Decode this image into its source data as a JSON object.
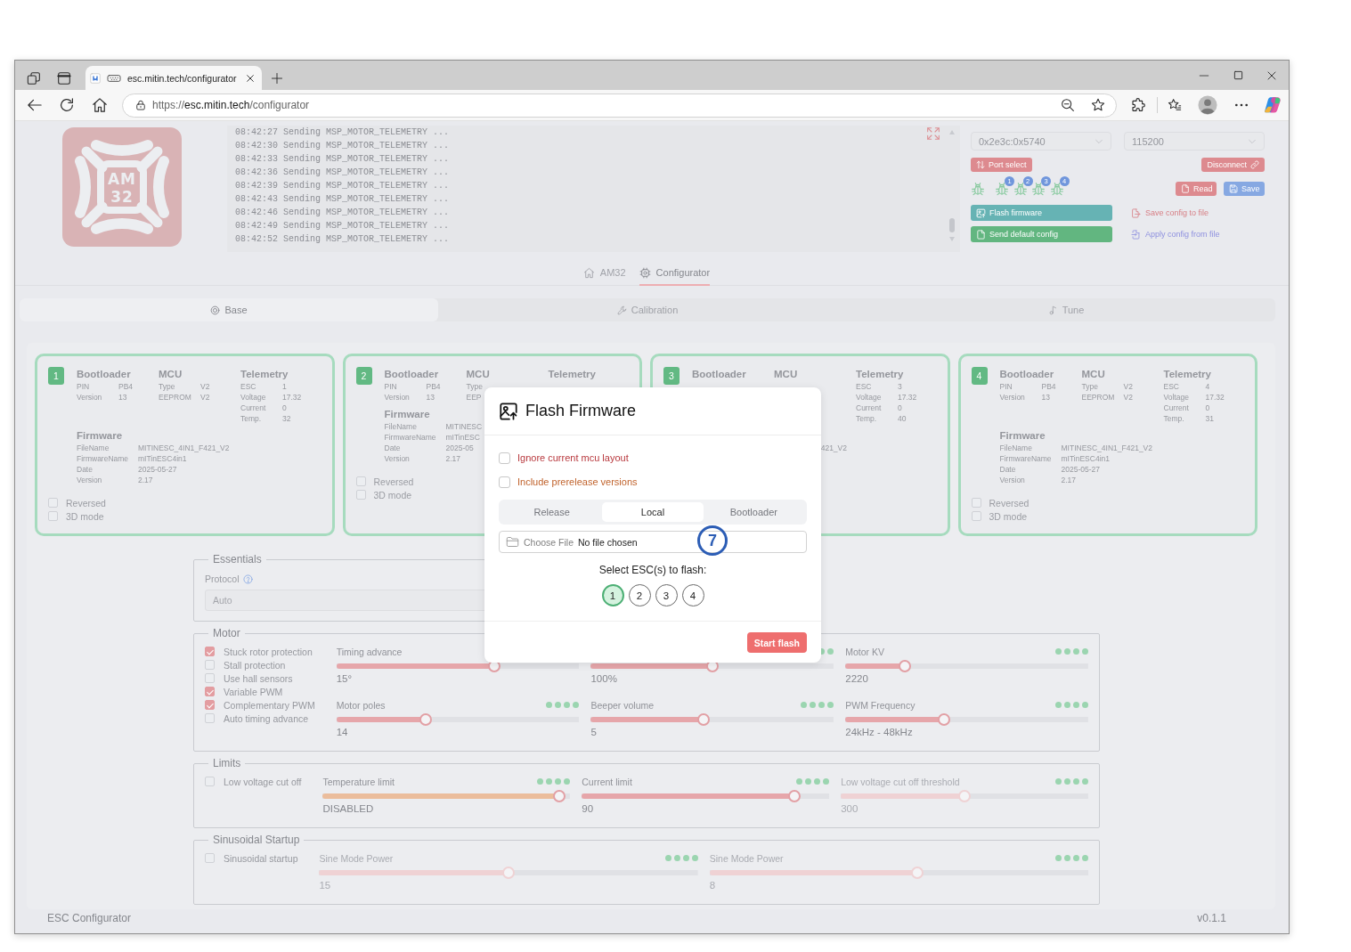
{
  "browser": {
    "tab_title": "esc.mitin.tech/configurator",
    "url": "https://**esc.mitin.tech**/configurator"
  },
  "logo": {
    "lines": [
      "AM",
      "32"
    ]
  },
  "log": {
    "lines": [
      "08:42:27 Sending MSP_MOTOR_TELEMETRY ...",
      "08:42:30 Sending MSP_MOTOR_TELEMETRY ...",
      "08:42:33 Sending MSP_MOTOR_TELEMETRY ...",
      "08:42:36 Sending MSP_MOTOR_TELEMETRY ...",
      "08:42:39 Sending MSP_MOTOR_TELEMETRY ...",
      "08:42:43 Sending MSP_MOTOR_TELEMETRY ...",
      "08:42:46 Sending MSP_MOTOR_TELEMETRY ...",
      "08:42:49 Sending MSP_MOTOR_TELEMETRY ...",
      "08:42:52 Sending MSP_MOTOR_TELEMETRY ..."
    ]
  },
  "connection": {
    "port": "0x2e3c:0x5740",
    "baud": "115200",
    "port_select": "Port select",
    "disconnect": "Disconnect",
    "devices": [
      {
        "kind": "plain"
      },
      {
        "kind": "numbered",
        "badge": "1"
      },
      {
        "kind": "numbered",
        "badge": "2"
      },
      {
        "kind": "numbered",
        "badge": "3"
      },
      {
        "kind": "numbered",
        "badge": "4"
      }
    ],
    "read": "Read",
    "save": "Save",
    "flash_firmware": "Flash firmware",
    "send_default_config": "Send default config",
    "save_config": "Save config to file",
    "apply_config": "Apply config from file"
  },
  "nav": [
    {
      "label": "AM32",
      "selected": false
    },
    {
      "label": "Configurator",
      "selected": true
    }
  ],
  "sections": [
    {
      "label": "Base",
      "selected": true
    },
    {
      "label": "Calibration",
      "selected": false
    },
    {
      "label": "Tune",
      "selected": false
    }
  ],
  "escs": [
    {
      "number": "1",
      "sections": [
        {
          "title": "Bootloader",
          "rows": [
            {
              "label": "PIN",
              "value": "PB4"
            },
            {
              "label": "Version",
              "value": "13"
            }
          ]
        },
        {
          "title": "MCU",
          "rows": [
            {
              "label": "Type",
              "value": "V2"
            },
            {
              "label": "EEPROM",
              "value": "V2"
            }
          ]
        },
        {
          "title": "Telemetry",
          "rows": [
            {
              "label": "ESC",
              "value": "1"
            },
            {
              "label": "Voltage",
              "value": "17.32"
            },
            {
              "label": "Current",
              "value": "0"
            },
            {
              "label": "Temp.",
              "value": "32"
            }
          ]
        }
      ],
      "firmware": {
        "title": "Firmware",
        "rows": [
          {
            "label": "FileName",
            "value": "MITINESC_4IN1_F421_V2"
          },
          {
            "label": "FirmwareName",
            "value": "mITinESC4in1"
          },
          {
            "label": "Date",
            "value": "2025-05-27"
          },
          {
            "label": "Version",
            "value": "2.17"
          }
        ]
      },
      "options": [
        {
          "label": "Reversed",
          "checked": false
        },
        {
          "label": "3D mode",
          "checked": false
        }
      ]
    },
    {
      "number": "2",
      "sections": [
        {
          "title": "Bootloader",
          "rows": [
            {
              "label": "PIN",
              "value": "PB4"
            },
            {
              "label": "Version",
              "value": "13"
            }
          ]
        },
        {
          "title": "MCU",
          "rows": [
            {
              "label": "Type"
            },
            {
              "label": "EEP"
            }
          ]
        },
        {
          "title": "Telemetry"
        }
      ],
      "firmware": {
        "title": "Firmware",
        "rows": [
          {
            "label": "FileName",
            "value": "MITINESC"
          },
          {
            "label": "FirmwareName",
            "value": "mITinESC"
          },
          {
            "label": "Date",
            "value": "2025-05"
          },
          {
            "label": "Version",
            "value": "2.17"
          }
        ]
      },
      "options": [
        {
          "label": "Reversed",
          "checked": false
        },
        {
          "label": "3D mode",
          "checked": false
        }
      ]
    },
    {
      "number": "3",
      "sections": [
        {
          "title": "Bootloader"
        },
        {
          "title": "MCU"
        },
        {
          "title": "Telemetry",
          "rows": [
            {
              "label": "ESC",
              "value": "3"
            },
            {
              "label": "Voltage",
              "value": "17.32"
            },
            {
              "label": "Current",
              "value": "0"
            },
            {
              "label": "Temp.",
              "value": "40"
            }
          ]
        }
      ],
      "firmware": {
        "rows": [
          {
            "value": "421_V2"
          }
        ]
      }
    },
    {
      "number": "4",
      "sections": [
        {
          "title": "Bootloader",
          "rows": [
            {
              "label": "PIN",
              "value": "PB4"
            },
            {
              "label": "Version",
              "value": "13"
            }
          ]
        },
        {
          "title": "MCU",
          "rows": [
            {
              "label": "Type",
              "value": "V2"
            },
            {
              "label": "EEPROM",
              "value": "V2"
            }
          ]
        },
        {
          "title": "Telemetry",
          "rows": [
            {
              "label": "ESC",
              "value": "4"
            },
            {
              "label": "Voltage",
              "value": "17.32"
            },
            {
              "label": "Current",
              "value": "0"
            },
            {
              "label": "Temp.",
              "value": "31"
            }
          ]
        }
      ],
      "firmware": {
        "title": "Firmware",
        "rows": [
          {
            "label": "FileName",
            "value": "MITINESC_4IN1_F421_V2"
          },
          {
            "label": "FirmwareName",
            "value": "mITinESC4in1"
          },
          {
            "label": "Date",
            "value": "2025-05-27"
          },
          {
            "label": "Version",
            "value": "2.17"
          }
        ]
      },
      "options": [
        {
          "label": "Reversed",
          "checked": false
        },
        {
          "label": "3D mode",
          "checked": false
        }
      ]
    }
  ],
  "settings": [
    {
      "title": "Essentials",
      "kind": "select",
      "label": "Protocol",
      "value": "Auto"
    },
    {
      "title": "Motor",
      "kind": "grid",
      "checkboxes": [
        {
          "label": "Stuck rotor protection",
          "checked": true
        },
        {
          "label": "Stall protection",
          "checked": false
        },
        {
          "label": "Use hall sensors",
          "checked": false
        },
        {
          "label": "Variable PWM",
          "checked": true
        },
        {
          "label": "Complementary PWM",
          "checked": true
        },
        {
          "label": "Auto timing advance",
          "checked": false
        }
      ],
      "slider_rows": [
        [
          {
            "label": "Timing advance",
            "value": "15°",
            "level": 0.66,
            "indicators": false,
            "disabled": false,
            "color": "#e6a6aa"
          },
          {
            "value": "100%",
            "level": 0.5,
            "indicators": true,
            "disabled": false,
            "color": "#e6a6aa"
          },
          {
            "label": "Motor KV",
            "value": "2220",
            "level": 0.23,
            "indicators": true,
            "disabled": false,
            "color": "#e6a6aa"
          }
        ],
        [
          {
            "label": "Motor poles",
            "value": "14",
            "level": 0.36,
            "indicators": true,
            "disabled": false,
            "color": "#e6a6aa"
          },
          {
            "label": "Beeper volume",
            "value": "5",
            "level": 0.46,
            "indicators": true,
            "disabled": false,
            "color": "#e6a6aa"
          },
          {
            "label": "PWM Frequency",
            "value": "24kHz - 48kHz",
            "level": 0.4,
            "indicators": true,
            "disabled": false,
            "color": "#e6a6aa"
          }
        ]
      ]
    },
    {
      "title": "Limits",
      "kind": "grid",
      "checkboxes": [
        {
          "label": "Low voltage cut off",
          "checked": false
        }
      ],
      "slider_rows": [
        [
          {
            "label": "Temperature limit",
            "value": "DISABLED",
            "level": 0.98,
            "indicators": true,
            "disabled": false,
            "color": "#ebbd9c"
          },
          {
            "label": "Current limit",
            "value": "90",
            "level": 0.88,
            "indicators": true,
            "disabled": false,
            "color": "#e6a6aa"
          },
          {
            "label": "Low voltage cut off threshold",
            "value": "300",
            "level": 0.5,
            "indicators": true,
            "disabled": true,
            "color": "#efd2d4"
          }
        ]
      ]
    },
    {
      "title": "Sinusoidal Startup",
      "kind": "grid",
      "checkboxes": [
        {
          "label": "Sinusoidal startup",
          "checked": false
        }
      ],
      "slider_rows": [
        [
          {
            "label": "Sine Mode Power",
            "value": "15",
            "level": 0.5,
            "indicators": true,
            "disabled": true,
            "color": "#efd2d4"
          },
          {
            "label": "Sine Mode Power",
            "value": "8",
            "level": 0.55,
            "indicators": true,
            "disabled": true,
            "color": "#efd2d4"
          }
        ]
      ]
    }
  ],
  "modal": {
    "title": "Flash Firmware",
    "options": [
      {
        "label": "Ignore current mcu layout",
        "checked": false,
        "color": "#b8393e"
      },
      {
        "label": "Include prerelease versions",
        "checked": false,
        "color": "#c0622b"
      }
    ],
    "tabs": [
      {
        "label": "Release",
        "selected": false
      },
      {
        "label": "Local",
        "selected": true
      },
      {
        "label": "Bootloader",
        "selected": false
      }
    ],
    "file_button": "Choose File",
    "file_status": "No file chosen",
    "prompt": "Select ESC(s) to flash:",
    "targets": [
      {
        "label": "1",
        "selected": true
      },
      {
        "label": "2",
        "selected": false
      },
      {
        "label": "3",
        "selected": false
      },
      {
        "label": "4",
        "selected": false
      }
    ],
    "start_button": "Start flash"
  },
  "callout": {
    "label": "7"
  },
  "footer": {
    "app_name": "ESC Configurator",
    "version": "v0.1.1"
  }
}
